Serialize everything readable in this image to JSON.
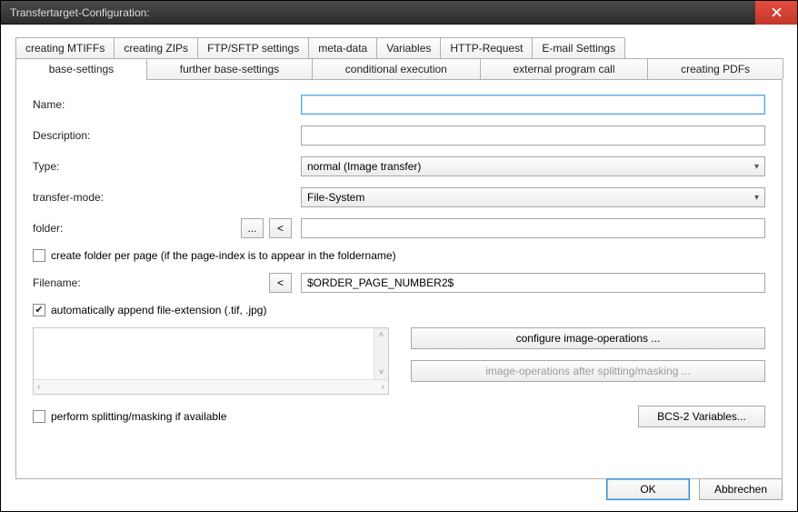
{
  "window": {
    "title": "Transfertarget-Configuration:"
  },
  "tabs": {
    "row1": [
      "creating MTIFFs",
      "creating ZIPs",
      "FTP/SFTP settings",
      "meta-data",
      "Variables",
      "HTTP-Request",
      "E-mail Settings"
    ],
    "row2": [
      "base-settings",
      "further base-settings",
      "conditional execution",
      "external program call",
      "creating PDFs"
    ],
    "active": "base-settings"
  },
  "form": {
    "name_label": "Name:",
    "name_value": "",
    "desc_label": "Description:",
    "desc_value": "",
    "type_label": "Type:",
    "type_value": "normal (Image transfer)",
    "mode_label": "transfer-mode:",
    "mode_value": "File-System",
    "folder_label": "folder:",
    "folder_value": "",
    "browse_btn": "...",
    "back_btn": "<",
    "create_folder_label": "create folder per page (if the page-index is to appear in the foldername)",
    "create_folder_checked": false,
    "filename_label": "Filename:",
    "filename_back_btn": "<",
    "filename_value": "$ORDER_PAGE_NUMBER2$",
    "append_ext_label": "automatically append file-extension (.tif, .jpg)",
    "append_ext_checked": true,
    "configure_ops_btn": "configure image-operations ...",
    "ops_after_split_btn": "image-operations after splitting/masking ...",
    "perform_split_label": "perform splitting/masking if available",
    "perform_split_checked": false,
    "bcs_btn": "BCS-2 Variables..."
  },
  "footer": {
    "ok": "OK",
    "cancel": "Abbrechen"
  }
}
